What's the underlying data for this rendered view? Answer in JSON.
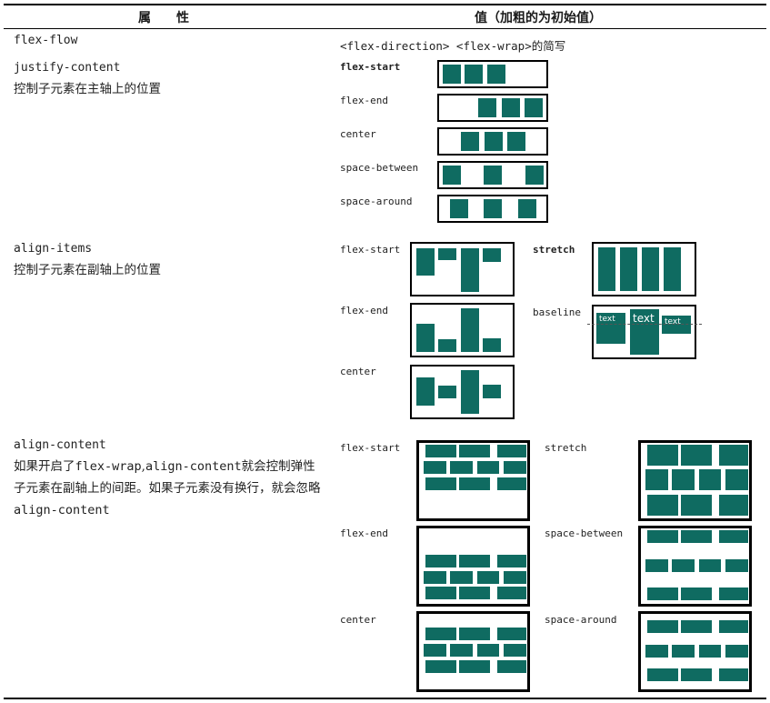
{
  "header": {
    "col1": "属　　性",
    "col2": "值（加粗的为初始值）"
  },
  "rows": {
    "flex_flow": {
      "property": "flex-flow",
      "value": "<flex-direction> <flex-wrap>的简写"
    },
    "justify_content": {
      "property": "justify-content",
      "description": "控制子元素在主轴上的位置",
      "options": [
        "flex-start",
        "flex-end",
        "center",
        "space-between",
        "space-around"
      ]
    },
    "align_items": {
      "property": "align-items",
      "description": "控制子元素在副轴上的位置",
      "options": [
        "flex-start",
        "flex-end",
        "center",
        "stretch",
        "baseline"
      ],
      "baseline_texts": [
        "text",
        "text",
        "text"
      ]
    },
    "align_content": {
      "property": "align-content",
      "description_parts": [
        "如果开启了",
        "flex-wrap",
        ",",
        "align-content",
        "就会控制弹性子元素在副轴上的间距。如果子元素没有换行，就会忽略",
        "align-content"
      ],
      "options": [
        "flex-start",
        "flex-end",
        "center",
        "stretch",
        "space-between",
        "space-around"
      ]
    }
  },
  "colors": {
    "item_fill": "#0f6b61",
    "border": "#000000"
  }
}
